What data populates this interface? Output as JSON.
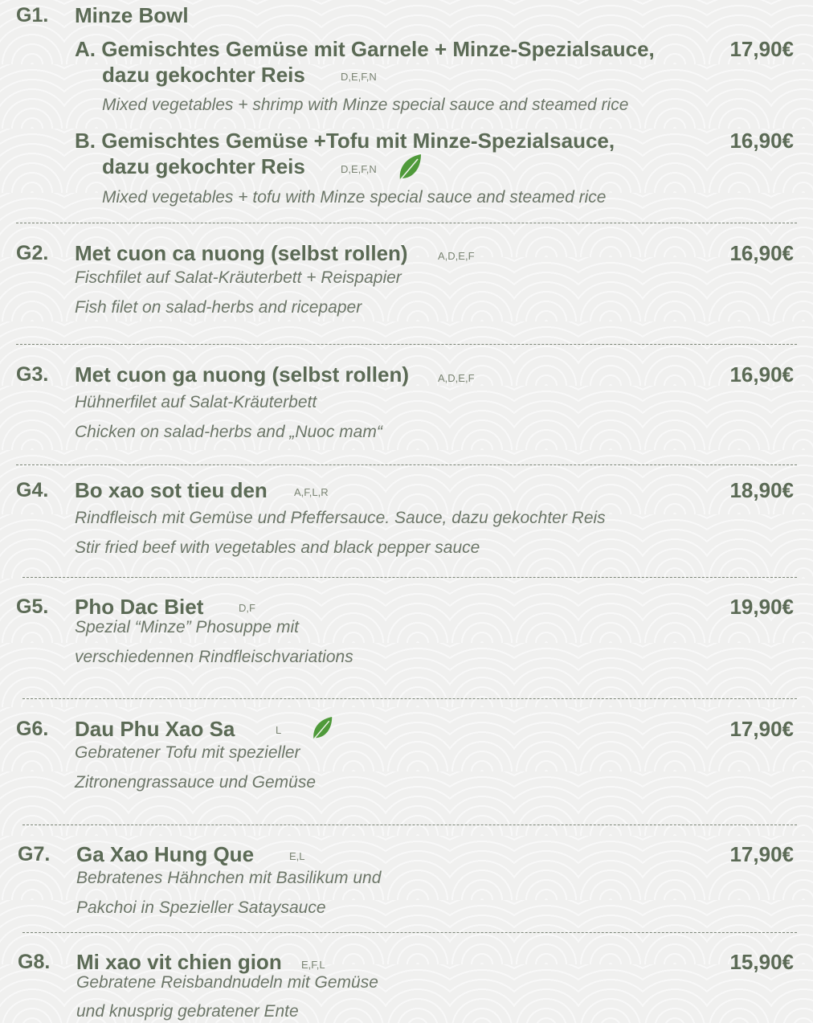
{
  "items": {
    "g1": {
      "code": "G1.",
      "name": "Minze Bowl",
      "a": {
        "line1": "A. Gemischtes Gemüse mit Garnele + Minze-Spezialsauce,",
        "line2": "dazu gekochter Reis",
        "allergens": "D,E,F,N",
        "price": "17,90€",
        "english": "Mixed vegetables + shrimp with Minze special sauce and steamed rice"
      },
      "b": {
        "line1": "B. Gemischtes Gemüse +Tofu mit Minze-Spezialsauce,",
        "line2": "dazu gekochter Reis",
        "allergens": "D,E,F,N",
        "price": "16,90€",
        "english": "Mixed vegetables + tofu with Minze special sauce and steamed rice",
        "icon": "vegetarian-leaf-icon"
      }
    },
    "g2": {
      "code": "G2.",
      "name": "Met cuon ca nuong (selbst rollen)",
      "allergens": "A,D,E,F",
      "price": "16,90€",
      "desc1": "Fischfilet auf Salat-Kräuterbett + Reispapier",
      "desc2": "Fish filet on salad-herbs and ricepaper"
    },
    "g3": {
      "code": "G3.",
      "name": "Met cuon ga nuong (selbst rollen)",
      "allergens": "A,D,E,F",
      "price": "16,90€",
      "desc1": "Hühnerfilet auf Salat-Kräuterbett",
      "desc2": "Chicken on salad-herbs and „Nuoc mam“"
    },
    "g4": {
      "code": "G4.",
      "name": "Bo xao sot tieu den",
      "allergens": "A,F,L,R",
      "price": "18,90€",
      "desc1": "Rindfleisch mit Gemüse und Pfeffersauce. Sauce, dazu gekochter Reis",
      "desc2": "Stir fried beef with vegetables and black pepper sauce"
    },
    "g5": {
      "code": "G5.",
      "name": "Pho Dac Biet",
      "allergens": "D,F",
      "price": "19,90€",
      "desc1": "Spezial “Minze” Phosuppe mit",
      "desc2": "verschiedennen Rindfleischvariations"
    },
    "g6": {
      "code": "G6.",
      "name": "Dau Phu Xao Sa",
      "allergens": "L",
      "price": "17,90€",
      "desc1": "Gebratener Tofu mit spezieller",
      "desc2": "Zitronengrassauce und Gemüse",
      "icon": "vegetarian-leaf-icon"
    },
    "g7": {
      "code": "G7.",
      "name": "Ga Xao Hung Que",
      "allergens": "E,L",
      "price": "17,90€",
      "desc1": "Bebratenes Hähnchen mit Basilikum und",
      "desc2": "Pakchoi in Spezieller Sataysauce"
    },
    "g8": {
      "code": "G8.",
      "name": "Mi xao vit chien gion",
      "allergens": "E,F,L",
      "price": "15,90€",
      "desc1": "Gebratene Reisbandnudeln mit Gemüse",
      "desc2": "und knusprig gebratener Ente"
    }
  },
  "colors": {
    "text": "#5b6a55",
    "leaf": "#4f9a3a",
    "background": "#f0f0ef"
  }
}
